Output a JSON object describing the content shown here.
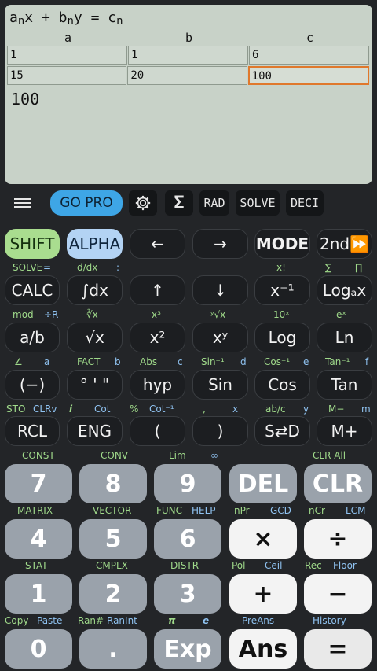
{
  "display": {
    "equation_a": "a",
    "equation_a_sub": "n",
    "equation_mid1": "x + b",
    "equation_b_sub": "n",
    "equation_mid2": "y = c",
    "equation_c_sub": "n",
    "col_a": "a",
    "col_b": "b",
    "col_c": "c",
    "rows": [
      [
        "1",
        "1",
        "6"
      ],
      [
        "15",
        "20",
        "100"
      ]
    ],
    "result": "100"
  },
  "toolbar": {
    "gopro": "GO PRO",
    "sigma": "Σ",
    "rad": "RAD",
    "solve": "SOLVE",
    "deci": "DECI"
  },
  "keys": {
    "shift": "SHIFT",
    "alpha": "ALPHA",
    "left": "←",
    "right": "→",
    "mode": "MODE",
    "second": "2nd⏩",
    "calc": "CALC",
    "integral": "∫dx",
    "up": "↑",
    "down": "↓",
    "xinv": "x⁻¹",
    "logax": "Logₐx",
    "ab": "a/b",
    "sqrt": "√x",
    "x2": "x²",
    "xy": "xʸ",
    "log": "Log",
    "ln": "Ln",
    "neg": "(−)",
    "deg": "° ' \"",
    "hyp": "hyp",
    "sin": "Sin",
    "cos": "Cos",
    "tan": "Tan",
    "rcl": "RCL",
    "eng": "ENG",
    "lparen": "(",
    "rparen": ")",
    "sd": "S⇄D",
    "mplus": "M+",
    "n7": "7",
    "n8": "8",
    "n9": "9",
    "del": "DEL",
    "clr": "CLR",
    "n4": "4",
    "n5": "5",
    "n6": "6",
    "mul": "×",
    "div": "÷",
    "n1": "1",
    "n2": "2",
    "n3": "3",
    "plus": "+",
    "minus": "−",
    "n0": "0",
    "dot": ".",
    "exp": "Exp",
    "ans": "Ans",
    "eq": "="
  },
  "labels": {
    "r1": [
      "SOLVE",
      "=",
      "d/dx",
      ":",
      "x!",
      "∑",
      "∏"
    ],
    "r2": [
      "mod",
      "÷R",
      "∛x",
      "x³",
      "ʸ√x",
      "10ˣ",
      "eˣ"
    ],
    "r3": [
      "∠",
      "a",
      "FACT",
      "b",
      "Abs",
      "c",
      "Sin⁻¹",
      "d",
      "Cos⁻¹",
      "e",
      "Tan⁻¹",
      "f"
    ],
    "r4": [
      "STO",
      "CLRv",
      "i",
      "Cot",
      "%",
      "Cot⁻¹",
      ",",
      "x",
      "ab/c",
      "y",
      "M−",
      "m"
    ],
    "r5": [
      "CONST",
      "CONV",
      "Lim",
      "∞",
      "CLR All"
    ],
    "r6": [
      "MATRIX",
      "VECTOR",
      "FUNC",
      "HELP",
      "nPr",
      "GCD",
      "nCr",
      "LCM"
    ],
    "r7": [
      "STAT",
      "CMPLX",
      "DISTR",
      "Pol",
      "Ceil",
      "Rec",
      "Floor"
    ],
    "r8": [
      "Copy",
      "Paste",
      "Ran#",
      "RanInt",
      "π",
      "e",
      "PreAns",
      "History"
    ]
  }
}
